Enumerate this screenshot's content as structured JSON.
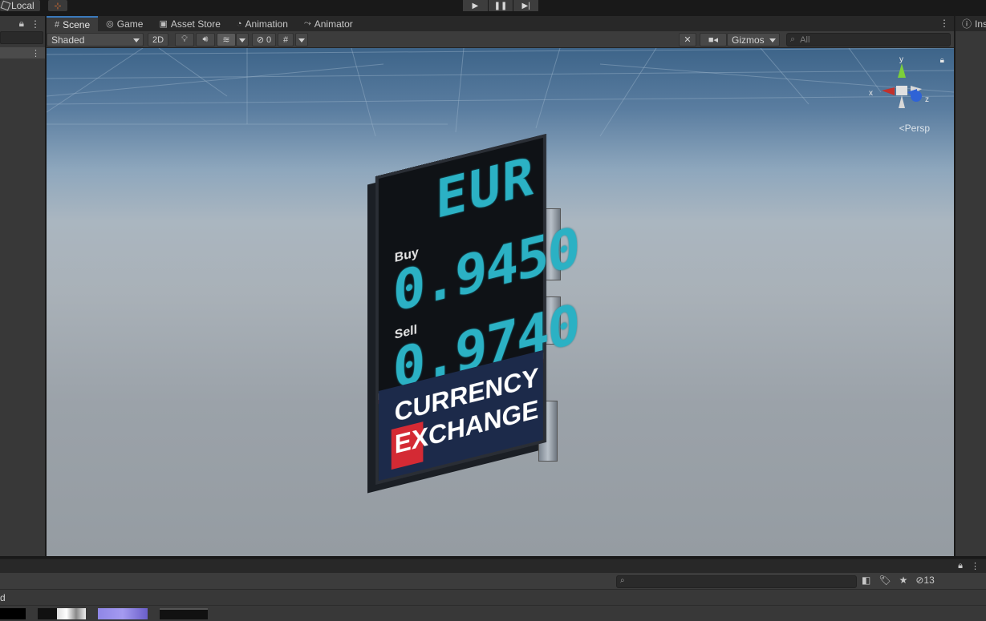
{
  "toolbar": {
    "pivot_label": "Local",
    "play_icon": "▶",
    "pause_icon": "❚❚",
    "step_icon": "▶|"
  },
  "tabs": [
    {
      "label": "Scene",
      "icon": "#"
    },
    {
      "label": "Game",
      "icon": "◎"
    },
    {
      "label": "Asset Store",
      "icon": "▣"
    },
    {
      "label": "Animation",
      "icon": "◔"
    },
    {
      "label": "Animator",
      "icon": "⤳"
    }
  ],
  "scene_toolbar": {
    "shading_mode": "Shaded",
    "mode_2d": "2D",
    "hidden_count": "0",
    "gizmos_label": "Gizmos",
    "search_placeholder": "All"
  },
  "viewport": {
    "projection_label": "Persp",
    "axis_x": "x",
    "axis_y": "y",
    "axis_z": "z"
  },
  "sign": {
    "currency_code": "EUR",
    "buy_label": "Buy",
    "buy_rate": "0.9450",
    "sell_label": "Sell",
    "sell_rate": "0.9740",
    "banner_line1": "CURRENCY",
    "banner_line2_highlight": "EX",
    "banner_line2_rest": "CHANGE"
  },
  "inspector": {
    "tab_label": "Ins"
  },
  "project": {
    "breadcrumb": "d",
    "hidden_count": "13"
  },
  "colors": {
    "accent_tab": "#3a79bb",
    "digit_cyan": "#2bb1c4",
    "banner_navy": "#1c2a4a",
    "banner_red": "#d42a34"
  }
}
